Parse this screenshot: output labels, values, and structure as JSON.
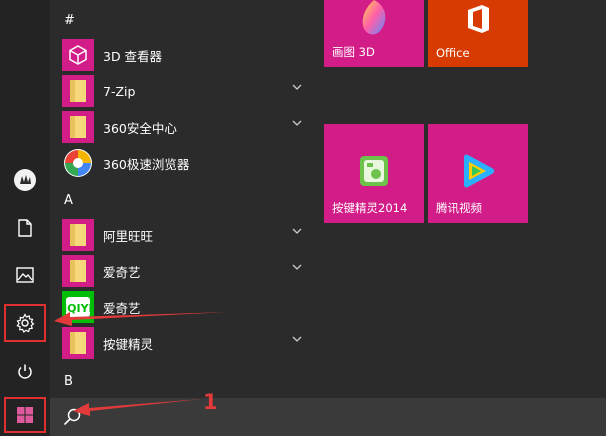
{
  "sections": {
    "hash": "#",
    "a": "A",
    "b": "B"
  },
  "apps": [
    {
      "label": "3D 查看器",
      "icon": "3d-cube-icon",
      "expandable": false
    },
    {
      "label": "7-Zip",
      "icon": "folder-icon",
      "expandable": true
    },
    {
      "label": "360安全中心",
      "icon": "folder-icon",
      "expandable": true
    },
    {
      "label": "360极速浏览器",
      "icon": "360-browser-icon",
      "expandable": false
    },
    {
      "label": "阿里旺旺",
      "icon": "folder-icon",
      "expandable": true
    },
    {
      "label": "爱奇艺",
      "icon": "folder-icon",
      "expandable": true
    },
    {
      "label": "爱奇艺",
      "icon": "iqiyi-icon",
      "expandable": false
    },
    {
      "label": "按键精灵",
      "icon": "folder-icon",
      "expandable": true
    }
  ],
  "tiles": {
    "paint3d": "画图 3D",
    "office": "Office",
    "anjian": "按键精灵2014",
    "tencent": "腾讯视频"
  },
  "annotation": {
    "number": "1"
  },
  "colors": {
    "tile_magenta": "#d21c87",
    "office_orange": "#d83b01",
    "highlight_red": "#e03030",
    "folder_yellow": "#f6d77a"
  }
}
